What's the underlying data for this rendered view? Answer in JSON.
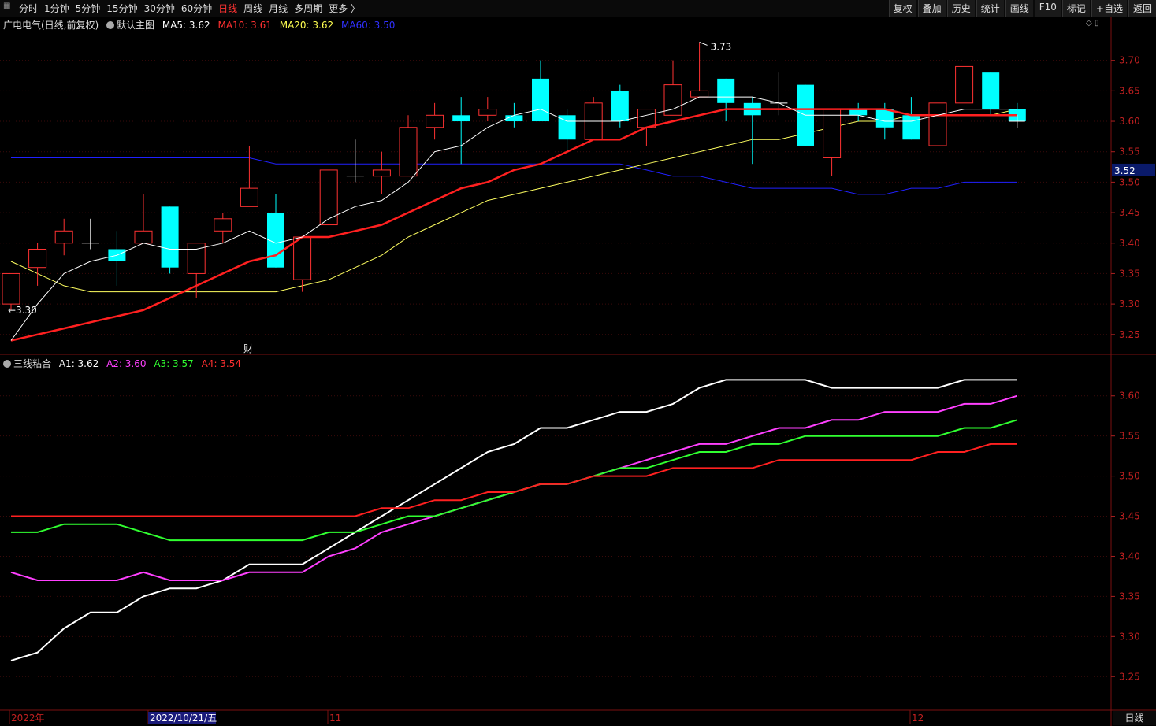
{
  "toolbar": {
    "menu_icon": "grid-menu-icon",
    "periods": [
      "分时",
      "1分钟",
      "5分钟",
      "15分钟",
      "30分钟",
      "60分钟",
      "日线",
      "周线",
      "月线",
      "多周期",
      "更多 〉"
    ],
    "active_period": "日线",
    "tools": [
      "复权",
      "叠加",
      "历史",
      "统计",
      "画线",
      "F10",
      "标记",
      "+自选",
      "返回"
    ]
  },
  "main_legend": {
    "stock": "广电电气(日线,前复权)",
    "template": "默认主图",
    "ma5": "MA5: 3.62",
    "ma10": "MA10: 3.61",
    "ma20": "MA20: 3.62",
    "ma60": "MA60: 3.50"
  },
  "sub_legend": {
    "name": "三线粘合",
    "a1": "A1: 3.62",
    "a2": "A2: 3.60",
    "a3": "A3: 3.57",
    "a4": "A4: 3.54"
  },
  "colors": {
    "up": "#ff3232",
    "down": "#00ffff",
    "ma5": "#ffffff",
    "ma10": "#ff2020",
    "ma20": "#ffff60",
    "ma60": "#2020ff",
    "a1": "#ffffff",
    "a2": "#ff40ff",
    "a3": "#30ff30",
    "a4": "#ff2020"
  },
  "labels": {
    "high": "3.73",
    "low": "3.30",
    "fin_marker": "财",
    "current_price": "3.52"
  },
  "x_axis": {
    "year": "2022年",
    "cursor_date": "2022/10/21/五",
    "m11": "11",
    "m12": "12",
    "period": "日线"
  },
  "chart_data": [
    {
      "type": "candlestick",
      "title": "广电电气(日线,前复权)",
      "y_ticks": [
        3.25,
        3.3,
        3.35,
        3.4,
        3.45,
        3.5,
        3.55,
        3.6,
        3.65,
        3.7
      ],
      "ylim": [
        3.22,
        3.75
      ],
      "candles": [
        {
          "o": 3.3,
          "c": 3.35,
          "h": 3.35,
          "l": 3.29
        },
        {
          "o": 3.36,
          "c": 3.39,
          "h": 3.4,
          "l": 3.33
        },
        {
          "o": 3.4,
          "c": 3.42,
          "h": 3.44,
          "l": 3.38
        },
        {
          "o": 3.4,
          "c": 3.4,
          "h": 3.44,
          "l": 3.39
        },
        {
          "o": 3.39,
          "c": 3.37,
          "h": 3.42,
          "l": 3.33
        },
        {
          "o": 3.4,
          "c": 3.42,
          "h": 3.48,
          "l": 3.4
        },
        {
          "o": 3.46,
          "c": 3.36,
          "h": 3.46,
          "l": 3.35
        },
        {
          "o": 3.35,
          "c": 3.4,
          "h": 3.4,
          "l": 3.31
        },
        {
          "o": 3.42,
          "c": 3.44,
          "h": 3.45,
          "l": 3.4
        },
        {
          "o": 3.46,
          "c": 3.49,
          "h": 3.56,
          "l": 3.46
        },
        {
          "o": 3.45,
          "c": 3.36,
          "h": 3.48,
          "l": 3.36
        },
        {
          "o": 3.34,
          "c": 3.41,
          "h": 3.41,
          "l": 3.32
        },
        {
          "o": 3.43,
          "c": 3.52,
          "h": 3.52,
          "l": 3.43
        },
        {
          "o": 3.51,
          "c": 3.51,
          "h": 3.57,
          "l": 3.5
        },
        {
          "o": 3.51,
          "c": 3.52,
          "h": 3.55,
          "l": 3.48
        },
        {
          "o": 3.51,
          "c": 3.59,
          "h": 3.61,
          "l": 3.51
        },
        {
          "o": 3.59,
          "c": 3.61,
          "h": 3.63,
          "l": 3.57
        },
        {
          "o": 3.61,
          "c": 3.6,
          "h": 3.64,
          "l": 3.53
        },
        {
          "o": 3.61,
          "c": 3.62,
          "h": 3.64,
          "l": 3.6
        },
        {
          "o": 3.61,
          "c": 3.6,
          "h": 3.63,
          "l": 3.59
        },
        {
          "o": 3.67,
          "c": 3.6,
          "h": 3.7,
          "l": 3.6
        },
        {
          "o": 3.61,
          "c": 3.57,
          "h": 3.62,
          "l": 3.55
        },
        {
          "o": 3.57,
          "c": 3.63,
          "h": 3.64,
          "l": 3.57
        },
        {
          "o": 3.65,
          "c": 3.6,
          "h": 3.66,
          "l": 3.59
        },
        {
          "o": 3.59,
          "c": 3.62,
          "h": 3.62,
          "l": 3.56
        },
        {
          "o": 3.61,
          "c": 3.66,
          "h": 3.7,
          "l": 3.61
        },
        {
          "o": 3.64,
          "c": 3.65,
          "h": 3.73,
          "l": 3.64
        },
        {
          "o": 3.67,
          "c": 3.63,
          "h": 3.67,
          "l": 3.6
        },
        {
          "o": 3.63,
          "c": 3.61,
          "h": 3.64,
          "l": 3.53
        },
        {
          "o": 3.63,
          "c": 3.63,
          "h": 3.68,
          "l": 3.61
        },
        {
          "o": 3.66,
          "c": 3.56,
          "h": 3.66,
          "l": 3.56
        },
        {
          "o": 3.54,
          "c": 3.62,
          "h": 3.62,
          "l": 3.51
        },
        {
          "o": 3.62,
          "c": 3.61,
          "h": 3.63,
          "l": 3.6
        },
        {
          "o": 3.62,
          "c": 3.59,
          "h": 3.63,
          "l": 3.57
        },
        {
          "o": 3.61,
          "c": 3.57,
          "h": 3.64,
          "l": 3.57
        },
        {
          "o": 3.56,
          "c": 3.63,
          "h": 3.63,
          "l": 3.56
        },
        {
          "o": 3.63,
          "c": 3.69,
          "h": 3.69,
          "l": 3.63
        },
        {
          "o": 3.68,
          "c": 3.62,
          "h": 3.68,
          "l": 3.61
        },
        {
          "o": 3.62,
          "c": 3.6,
          "h": 3.63,
          "l": 3.6
        }
      ],
      "ma5": [
        3.24,
        3.3,
        3.35,
        3.37,
        3.38,
        3.4,
        3.39,
        3.39,
        3.4,
        3.42,
        3.4,
        3.41,
        3.44,
        3.46,
        3.47,
        3.5,
        3.55,
        3.56,
        3.59,
        3.61,
        3.62,
        3.6,
        3.6,
        3.6,
        3.61,
        3.62,
        3.64,
        3.64,
        3.64,
        3.63,
        3.61,
        3.61,
        3.61,
        3.6,
        3.6,
        3.61,
        3.62,
        3.62,
        3.62
      ],
      "ma10": [
        3.24,
        3.25,
        3.26,
        3.27,
        3.28,
        3.29,
        3.31,
        3.33,
        3.35,
        3.37,
        3.38,
        3.41,
        3.41,
        3.42,
        3.43,
        3.45,
        3.47,
        3.49,
        3.5,
        3.52,
        3.53,
        3.55,
        3.57,
        3.57,
        3.59,
        3.6,
        3.61,
        3.62,
        3.62,
        3.62,
        3.62,
        3.62,
        3.62,
        3.62,
        3.61,
        3.61,
        3.61,
        3.61,
        3.61
      ],
      "ma20": [
        3.37,
        3.35,
        3.33,
        3.32,
        3.32,
        3.32,
        3.32,
        3.32,
        3.32,
        3.32,
        3.32,
        3.33,
        3.34,
        3.36,
        3.38,
        3.41,
        3.43,
        3.45,
        3.47,
        3.48,
        3.49,
        3.5,
        3.51,
        3.52,
        3.53,
        3.54,
        3.55,
        3.56,
        3.57,
        3.57,
        3.58,
        3.59,
        3.6,
        3.6,
        3.61,
        3.61,
        3.61,
        3.61,
        3.62
      ],
      "ma60": [
        3.54,
        3.54,
        3.54,
        3.54,
        3.54,
        3.54,
        3.54,
        3.54,
        3.54,
        3.54,
        3.53,
        3.53,
        3.53,
        3.53,
        3.53,
        3.53,
        3.53,
        3.53,
        3.53,
        3.53,
        3.53,
        3.53,
        3.53,
        3.53,
        3.52,
        3.51,
        3.51,
        3.5,
        3.49,
        3.49,
        3.49,
        3.49,
        3.48,
        3.48,
        3.49,
        3.49,
        3.5,
        3.5,
        3.5
      ]
    },
    {
      "type": "line",
      "title": "三线粘合",
      "y_ticks": [
        3.25,
        3.3,
        3.35,
        3.4,
        3.45,
        3.5,
        3.55,
        3.6
      ],
      "ylim": [
        3.21,
        3.64
      ],
      "series": [
        {
          "name": "A1",
          "values": [
            3.27,
            3.28,
            3.31,
            3.33,
            3.33,
            3.35,
            3.36,
            3.36,
            3.37,
            3.39,
            3.39,
            3.39,
            3.41,
            3.43,
            3.45,
            3.47,
            3.49,
            3.51,
            3.53,
            3.54,
            3.56,
            3.56,
            3.57,
            3.58,
            3.58,
            3.59,
            3.61,
            3.62,
            3.62,
            3.62,
            3.62,
            3.61,
            3.61,
            3.61,
            3.61,
            3.61,
            3.62,
            3.62,
            3.62
          ]
        },
        {
          "name": "A2",
          "values": [
            3.38,
            3.37,
            3.37,
            3.37,
            3.37,
            3.38,
            3.37,
            3.37,
            3.37,
            3.38,
            3.38,
            3.38,
            3.4,
            3.41,
            3.43,
            3.44,
            3.45,
            3.46,
            3.47,
            3.48,
            3.49,
            3.49,
            3.5,
            3.51,
            3.52,
            3.53,
            3.54,
            3.54,
            3.55,
            3.56,
            3.56,
            3.57,
            3.57,
            3.58,
            3.58,
            3.58,
            3.59,
            3.59,
            3.6
          ]
        },
        {
          "name": "A3",
          "values": [
            3.43,
            3.43,
            3.44,
            3.44,
            3.44,
            3.43,
            3.42,
            3.42,
            3.42,
            3.42,
            3.42,
            3.42,
            3.43,
            3.43,
            3.44,
            3.45,
            3.45,
            3.46,
            3.47,
            3.48,
            3.49,
            3.49,
            3.5,
            3.51,
            3.51,
            3.52,
            3.53,
            3.53,
            3.54,
            3.54,
            3.55,
            3.55,
            3.55,
            3.55,
            3.55,
            3.55,
            3.56,
            3.56,
            3.57
          ]
        },
        {
          "name": "A4",
          "values": [
            3.45,
            3.45,
            3.45,
            3.45,
            3.45,
            3.45,
            3.45,
            3.45,
            3.45,
            3.45,
            3.45,
            3.45,
            3.45,
            3.45,
            3.46,
            3.46,
            3.47,
            3.47,
            3.48,
            3.48,
            3.49,
            3.49,
            3.5,
            3.5,
            3.5,
            3.51,
            3.51,
            3.51,
            3.51,
            3.52,
            3.52,
            3.52,
            3.52,
            3.52,
            3.52,
            3.53,
            3.53,
            3.54,
            3.54
          ]
        }
      ]
    }
  ]
}
